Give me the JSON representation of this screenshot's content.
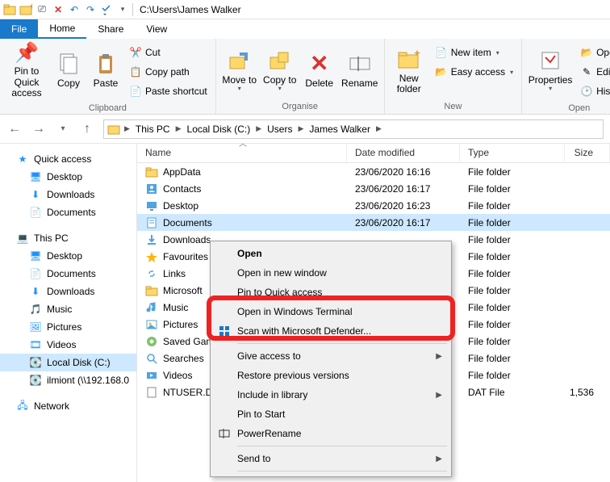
{
  "qat_path": "C:\\Users\\James Walker",
  "tabs": {
    "file": "File",
    "home": "Home",
    "share": "Share",
    "view": "View"
  },
  "ribbon": {
    "clipboard": {
      "label": "Clipboard",
      "pin": "Pin to Quick access",
      "copy": "Copy",
      "paste": "Paste",
      "cut": "Cut",
      "copy_path": "Copy path",
      "paste_shortcut": "Paste shortcut"
    },
    "organise": {
      "label": "Organise",
      "move": "Move to",
      "copy": "Copy to",
      "delete": "Delete",
      "rename": "Rename"
    },
    "new": {
      "label": "New",
      "new_folder": "New folder",
      "new_item": "New item",
      "easy_access": "Easy access"
    },
    "open": {
      "label": "Open",
      "properties": "Properties",
      "open": "Open",
      "edit": "Edit",
      "history": "History"
    }
  },
  "breadcrumb": [
    "This PC",
    "Local Disk (C:)",
    "Users",
    "James Walker"
  ],
  "sidebar": {
    "quick": "Quick access",
    "desktop": "Desktop",
    "downloads": "Downloads",
    "documents": "Documents",
    "thispc": "This PC",
    "music": "Music",
    "pictures": "Pictures",
    "videos": "Videos",
    "localdisk": "Local Disk (C:)",
    "ilmiont": "ilmiont (\\\\192.168.0",
    "network": "Network"
  },
  "columns": {
    "name": "Name",
    "date": "Date modified",
    "type": "Type",
    "size": "Size"
  },
  "rows": [
    {
      "icon": "folder",
      "name": "AppData",
      "date": "23/06/2020 16:16",
      "type": "File folder",
      "size": ""
    },
    {
      "icon": "contacts",
      "name": "Contacts",
      "date": "23/06/2020 16:17",
      "type": "File folder",
      "size": ""
    },
    {
      "icon": "desktop",
      "name": "Desktop",
      "date": "23/06/2020 16:23",
      "type": "File folder",
      "size": ""
    },
    {
      "icon": "documents",
      "name": "Documents",
      "date": "23/06/2020 16:17",
      "type": "File folder",
      "size": "",
      "sel": true
    },
    {
      "icon": "downloads",
      "name": "Downloads",
      "date": "",
      "type": "File folder",
      "size": ""
    },
    {
      "icon": "favourites",
      "name": "Favourites",
      "date": "",
      "type": "File folder",
      "size": ""
    },
    {
      "icon": "links",
      "name": "Links",
      "date": "",
      "type": "File folder",
      "size": ""
    },
    {
      "icon": "folder",
      "name": "Microsoft",
      "date": "",
      "type": "File folder",
      "size": ""
    },
    {
      "icon": "music",
      "name": "Music",
      "date": "",
      "type": "File folder",
      "size": ""
    },
    {
      "icon": "pictures",
      "name": "Pictures",
      "date": "",
      "type": "File folder",
      "size": ""
    },
    {
      "icon": "saved",
      "name": "Saved Games",
      "date": "",
      "type": "File folder",
      "size": ""
    },
    {
      "icon": "search",
      "name": "Searches",
      "date": "",
      "type": "File folder",
      "size": ""
    },
    {
      "icon": "videos",
      "name": "Videos",
      "date": "",
      "type": "File folder",
      "size": ""
    },
    {
      "icon": "file",
      "name": "NTUSER.DAT",
      "date": "",
      "type": "DAT File",
      "size": "1,536"
    }
  ],
  "context_menu": [
    {
      "label": "Open",
      "bold": true
    },
    {
      "label": "Open in new window"
    },
    {
      "label": "Pin to Quick access"
    },
    {
      "label": "Open in Windows Terminal"
    },
    {
      "label": "Scan with Microsoft Defender...",
      "icon": "defender"
    },
    {
      "sep": true
    },
    {
      "label": "Give access to",
      "sub": true,
      "obscured": true
    },
    {
      "label": "Restore previous versions"
    },
    {
      "label": "Include in library",
      "sub": true
    },
    {
      "label": "Pin to Start"
    },
    {
      "label": "PowerRename",
      "icon": "rename"
    },
    {
      "sep": true
    },
    {
      "label": "Send to",
      "sub": true
    },
    {
      "sep": true
    }
  ]
}
